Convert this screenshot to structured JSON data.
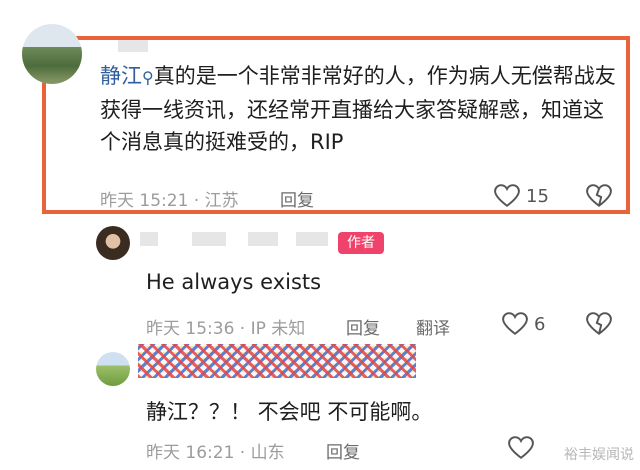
{
  "comment1": {
    "author": "静江",
    "text": "真的是一个非常非常好的人，作为病人无偿帮战友获得一线资讯，还经常开直播给大家答疑解惑，知道这个消息真的挺难受的，RIP",
    "meta": "昨天 15:21 · 江苏",
    "reply_label": "回复",
    "like_count": "15"
  },
  "comment2": {
    "badge": "作者",
    "text": "He always exists",
    "meta": "昨天 15:36 · IP 未知",
    "reply_label": "回复",
    "translate_label": "翻译",
    "like_count": "6"
  },
  "comment3": {
    "text": "静江？？！ 不会吧 不可能啊。",
    "meta": "昨天 16:21 · 山东",
    "reply_label": "回复"
  },
  "watermark": "裕丰娱闻说"
}
